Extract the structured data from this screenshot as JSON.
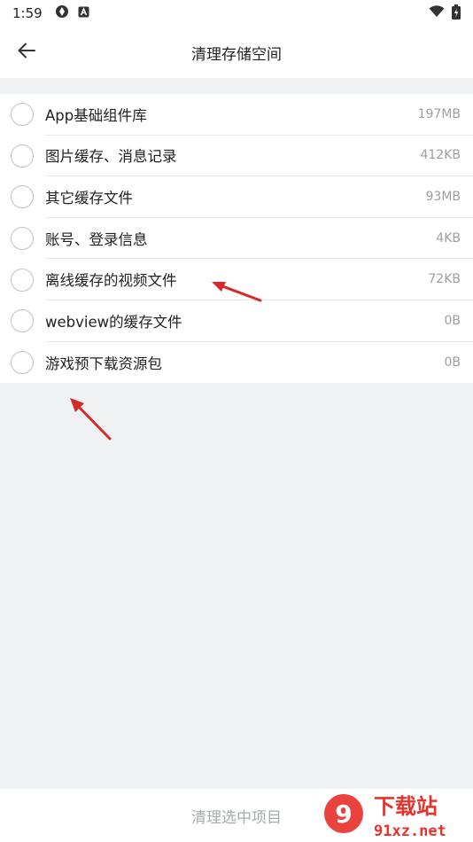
{
  "status_bar": {
    "time": "1:59",
    "icons": [
      "sync-icon",
      "a-badge-icon",
      "wifi-icon",
      "battery-charging-icon"
    ]
  },
  "header": {
    "title": "清理存储空间",
    "back_icon": "arrow-left-icon"
  },
  "items": [
    {
      "label": "App基础组件库",
      "size": "197MB"
    },
    {
      "label": "图片缓存、消息记录",
      "size": "412KB"
    },
    {
      "label": "其它缓存文件",
      "size": "93MB"
    },
    {
      "label": "账号、登录信息",
      "size": "4KB"
    },
    {
      "label": "离线缓存的视频文件",
      "size": "72KB"
    },
    {
      "label": "webview的缓存文件",
      "size": "0B"
    },
    {
      "label": "游戏预下载资源包",
      "size": "0B"
    }
  ],
  "bottom": {
    "clean_label": "清理选中项目"
  },
  "watermark": {
    "brand": "下载站",
    "domain": "91xz.net",
    "logo": "9"
  },
  "colors": {
    "background": "#f0f1f3",
    "annotation_arrow": "#d42a2a",
    "disabled_text": "#a6aab0",
    "watermark_red": "#e8322b"
  }
}
